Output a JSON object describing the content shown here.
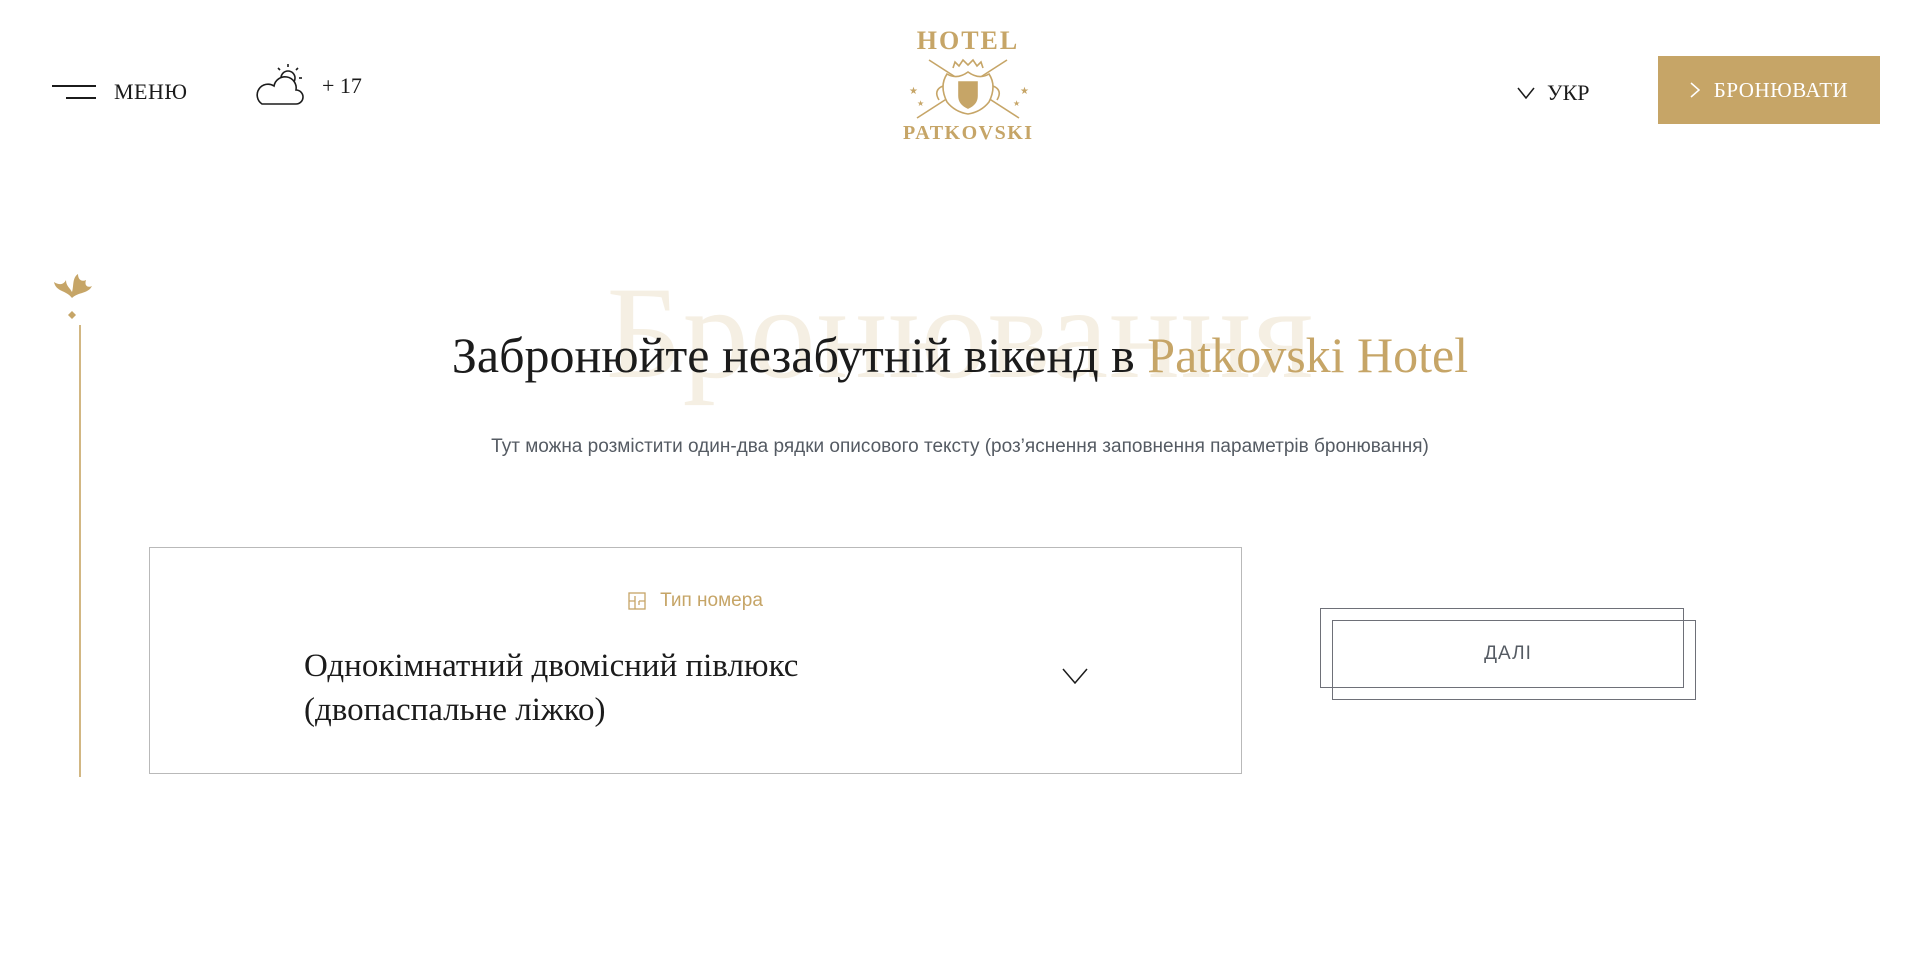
{
  "header": {
    "menu_label": "МЕНЮ",
    "temperature": "+ 17",
    "weather_icon": "partly-cloudy-icon",
    "logo": {
      "top_text": "HOTEL",
      "bottom_text": "PATKOVSKI"
    },
    "language": "УКР",
    "book_label": "БРОНЮВАТИ"
  },
  "hero": {
    "watermark": "Бронювання",
    "title_main": "Забронюйте незабутній вікенд в ",
    "title_accent": "Patkovski Hotel",
    "subtitle": "Тут можна розмістити один-два рядки описового тексту (роз’яснення заповнення параметрів бронювання)"
  },
  "booking": {
    "room_type_label": "Тип номера",
    "room_type_icon": "room-plan-icon",
    "room_value_line1": "Однокімнатний двомісний півлюкс",
    "room_value_line2": "(двопаспальне ліжко)",
    "next_label": "ДАЛІ"
  },
  "colors": {
    "accent": "#c6a567",
    "text": "#1b1b1b",
    "muted": "#555b63",
    "border": "#b9b9b9"
  }
}
